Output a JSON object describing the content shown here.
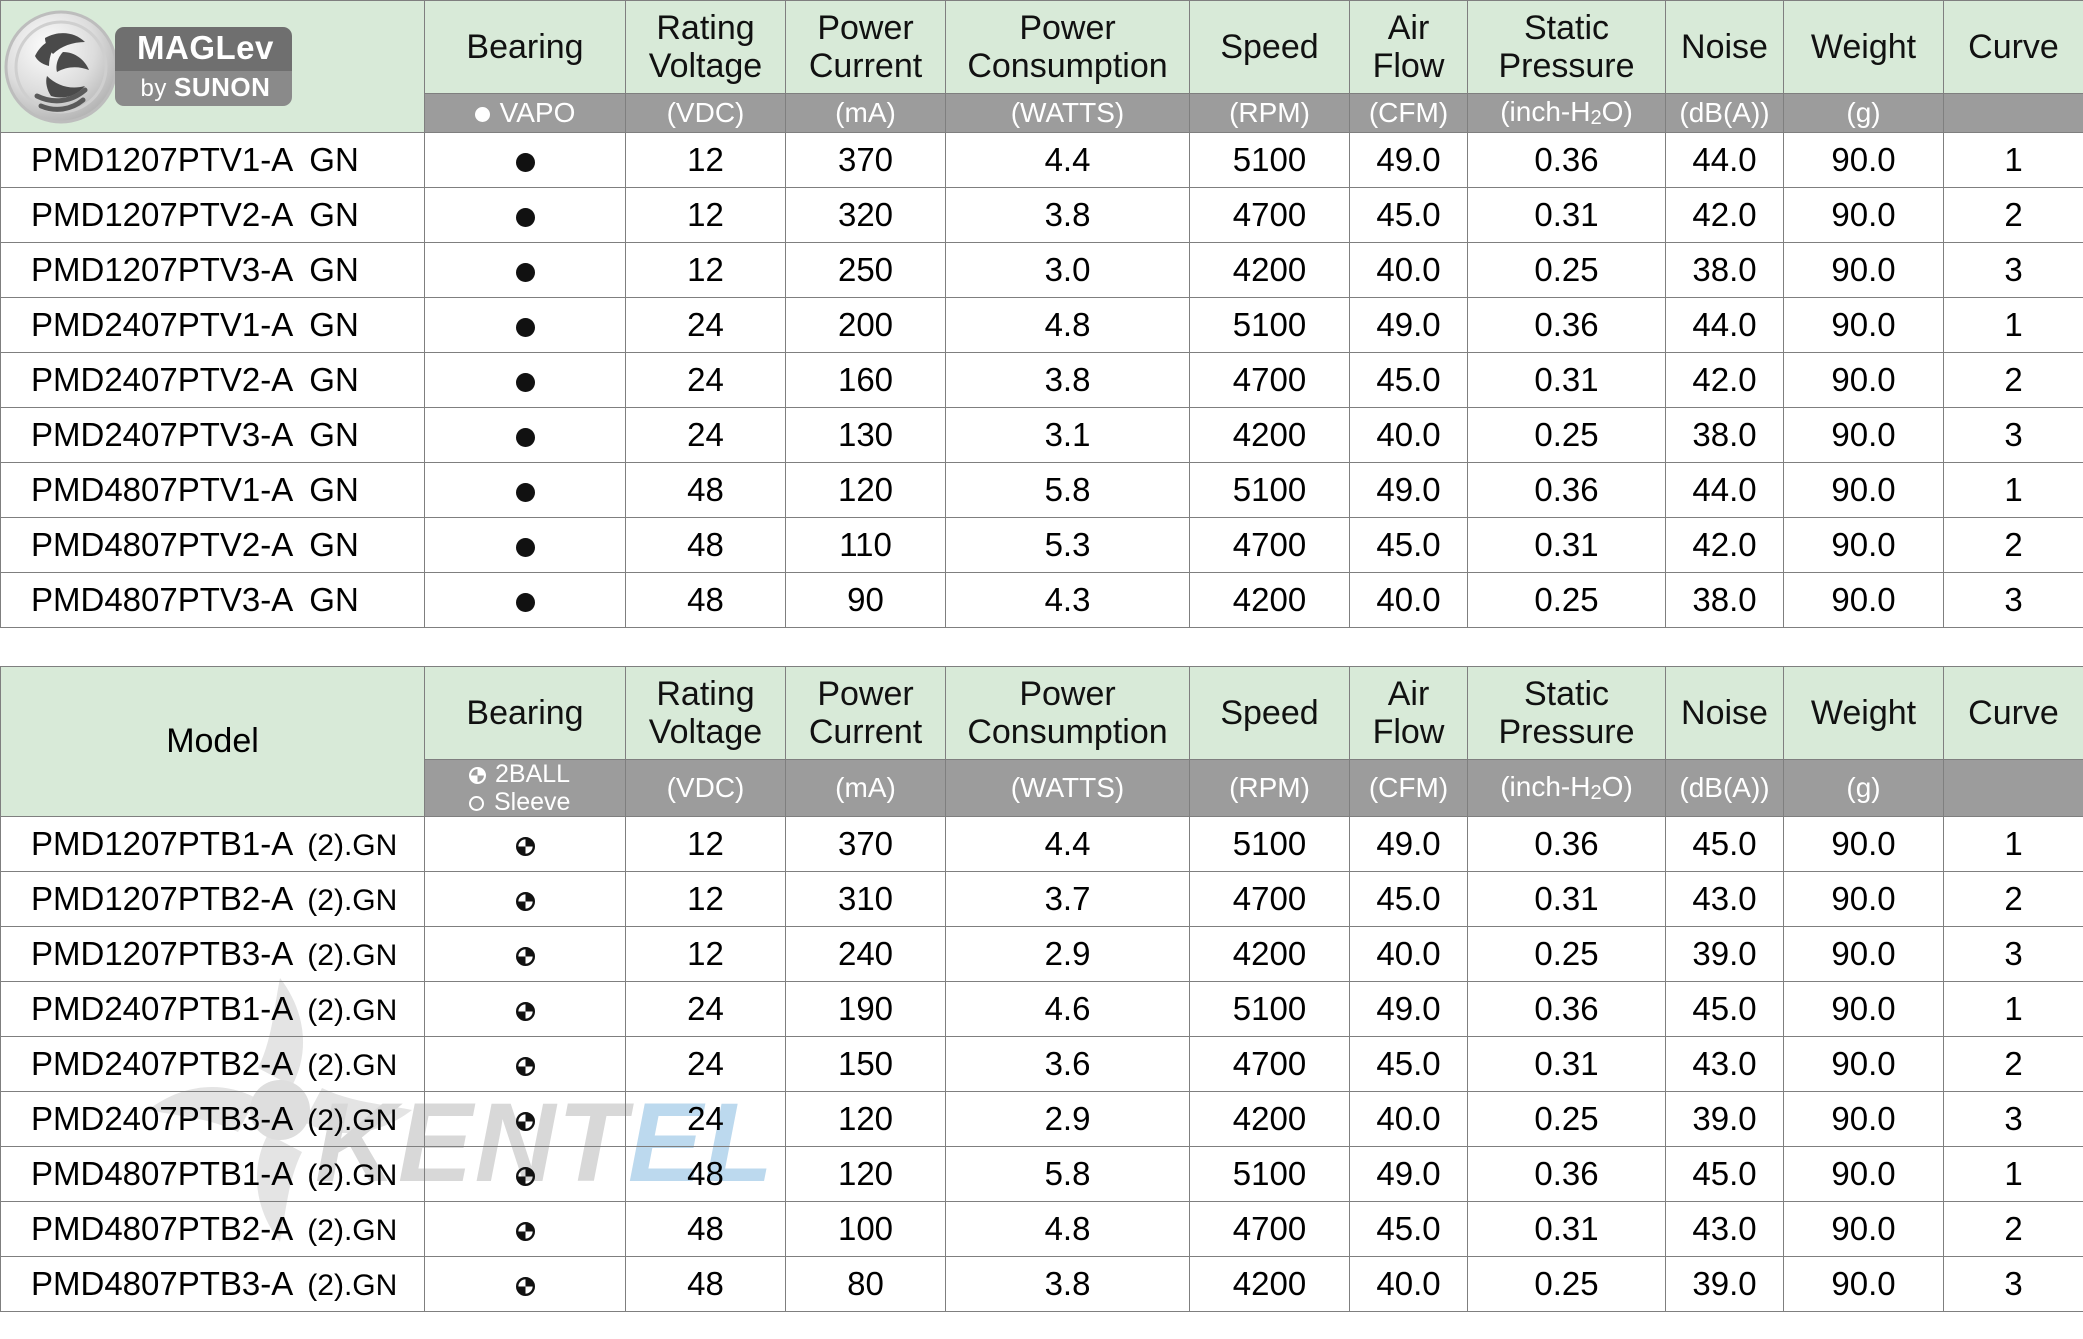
{
  "logo": {
    "brand_top": "MAGLev",
    "brand_bottom_prefix": "by ",
    "brand_bottom_name": "SUNON",
    "icon": "maglev-swirl-icon"
  },
  "watermark": {
    "text_dark": "KENT",
    "text_blue": "EL"
  },
  "columns": {
    "model": "Model",
    "bearing": "Bearing",
    "rating_voltage_l1": "Rating",
    "rating_voltage_l2": "Voltage",
    "power_current_l1": "Power",
    "power_current_l2": "Current",
    "power_consumption_l1": "Power",
    "power_consumption_l2": "Consumption",
    "speed": "Speed",
    "air_flow_l1": "Air",
    "air_flow_l2": "Flow",
    "static_pressure_l1": "Static",
    "static_pressure_l2": "Pressure",
    "noise": "Noise",
    "weight": "Weight",
    "curve": "Curve"
  },
  "units": {
    "bearing_vapo": "VAPO",
    "bearing_2ball": "2BALL",
    "bearing_sleeve": "Sleeve",
    "voltage": "(VDC)",
    "current": "(mA)",
    "consumption": "(WATTS)",
    "speed": "(RPM)",
    "air_flow": "(CFM)",
    "static_pressure_pre": "(inch-H",
    "static_pressure_sub": "2",
    "static_pressure_post": "O)",
    "noise": "(dB(A))",
    "weight": "(g)",
    "curve": ""
  },
  "table1": {
    "bearing_symbol": "filled-circle",
    "rows": [
      {
        "model": "PMD1207PTV1-A",
        "suffix": "GN",
        "voltage": "12",
        "current": "370",
        "consumption": "4.4",
        "speed": "5100",
        "air_flow": "49.0",
        "static_pressure": "0.36",
        "noise": "44.0",
        "weight": "90.0",
        "curve": "1"
      },
      {
        "model": "PMD1207PTV2-A",
        "suffix": "GN",
        "voltage": "12",
        "current": "320",
        "consumption": "3.8",
        "speed": "4700",
        "air_flow": "45.0",
        "static_pressure": "0.31",
        "noise": "42.0",
        "weight": "90.0",
        "curve": "2"
      },
      {
        "model": "PMD1207PTV3-A",
        "suffix": "GN",
        "voltage": "12",
        "current": "250",
        "consumption": "3.0",
        "speed": "4200",
        "air_flow": "40.0",
        "static_pressure": "0.25",
        "noise": "38.0",
        "weight": "90.0",
        "curve": "3"
      },
      {
        "model": "PMD2407PTV1-A",
        "suffix": "GN",
        "voltage": "24",
        "current": "200",
        "consumption": "4.8",
        "speed": "5100",
        "air_flow": "49.0",
        "static_pressure": "0.36",
        "noise": "44.0",
        "weight": "90.0",
        "curve": "1"
      },
      {
        "model": "PMD2407PTV2-A",
        "suffix": "GN",
        "voltage": "24",
        "current": "160",
        "consumption": "3.8",
        "speed": "4700",
        "air_flow": "45.0",
        "static_pressure": "0.31",
        "noise": "42.0",
        "weight": "90.0",
        "curve": "2"
      },
      {
        "model": "PMD2407PTV3-A",
        "suffix": "GN",
        "voltage": "24",
        "current": "130",
        "consumption": "3.1",
        "speed": "4200",
        "air_flow": "40.0",
        "static_pressure": "0.25",
        "noise": "38.0",
        "weight": "90.0",
        "curve": "3"
      },
      {
        "model": "PMD4807PTV1-A",
        "suffix": "GN",
        "voltage": "48",
        "current": "120",
        "consumption": "5.8",
        "speed": "5100",
        "air_flow": "49.0",
        "static_pressure": "0.36",
        "noise": "44.0",
        "weight": "90.0",
        "curve": "1"
      },
      {
        "model": "PMD4807PTV2-A",
        "suffix": "GN",
        "voltage": "48",
        "current": "110",
        "consumption": "5.3",
        "speed": "4700",
        "air_flow": "45.0",
        "static_pressure": "0.31",
        "noise": "42.0",
        "weight": "90.0",
        "curve": "2"
      },
      {
        "model": "PMD4807PTV3-A",
        "suffix": "GN",
        "voltage": "48",
        "current": "90",
        "consumption": "4.3",
        "speed": "4200",
        "air_flow": "40.0",
        "static_pressure": "0.25",
        "noise": "38.0",
        "weight": "90.0",
        "curve": "3"
      }
    ]
  },
  "table2": {
    "bearing_symbol": "quartered-circle",
    "rows": [
      {
        "model": "PMD1207PTB1-A",
        "suffix": "(2).GN",
        "voltage": "12",
        "current": "370",
        "consumption": "4.4",
        "speed": "5100",
        "air_flow": "49.0",
        "static_pressure": "0.36",
        "noise": "45.0",
        "weight": "90.0",
        "curve": "1"
      },
      {
        "model": "PMD1207PTB2-A",
        "suffix": "(2).GN",
        "voltage": "12",
        "current": "310",
        "consumption": "3.7",
        "speed": "4700",
        "air_flow": "45.0",
        "static_pressure": "0.31",
        "noise": "43.0",
        "weight": "90.0",
        "curve": "2"
      },
      {
        "model": "PMD1207PTB3-A",
        "suffix": "(2).GN",
        "voltage": "12",
        "current": "240",
        "consumption": "2.9",
        "speed": "4200",
        "air_flow": "40.0",
        "static_pressure": "0.25",
        "noise": "39.0",
        "weight": "90.0",
        "curve": "3"
      },
      {
        "model": "PMD2407PTB1-A",
        "suffix": "(2).GN",
        "voltage": "24",
        "current": "190",
        "consumption": "4.6",
        "speed": "5100",
        "air_flow": "49.0",
        "static_pressure": "0.36",
        "noise": "45.0",
        "weight": "90.0",
        "curve": "1"
      },
      {
        "model": "PMD2407PTB2-A",
        "suffix": "(2).GN",
        "voltage": "24",
        "current": "150",
        "consumption": "3.6",
        "speed": "4700",
        "air_flow": "45.0",
        "static_pressure": "0.31",
        "noise": "43.0",
        "weight": "90.0",
        "curve": "2"
      },
      {
        "model": "PMD2407PTB3-A",
        "suffix": "(2).GN",
        "voltage": "24",
        "current": "120",
        "consumption": "2.9",
        "speed": "4200",
        "air_flow": "40.0",
        "static_pressure": "0.25",
        "noise": "39.0",
        "weight": "90.0",
        "curve": "3"
      },
      {
        "model": "PMD4807PTB1-A",
        "suffix": "(2).GN",
        "voltage": "48",
        "current": "120",
        "consumption": "5.8",
        "speed": "5100",
        "air_flow": "49.0",
        "static_pressure": "0.36",
        "noise": "45.0",
        "weight": "90.0",
        "curve": "1"
      },
      {
        "model": "PMD4807PTB2-A",
        "suffix": "(2).GN",
        "voltage": "48",
        "current": "100",
        "consumption": "4.8",
        "speed": "4700",
        "air_flow": "45.0",
        "static_pressure": "0.31",
        "noise": "43.0",
        "weight": "90.0",
        "curve": "2"
      },
      {
        "model": "PMD4807PTB3-A",
        "suffix": "(2).GN",
        "voltage": "48",
        "current": "80",
        "consumption": "3.8",
        "speed": "4200",
        "air_flow": "40.0",
        "static_pressure": "0.25",
        "noise": "39.0",
        "weight": "90.0",
        "curve": "3"
      }
    ]
  },
  "colors": {
    "header_green": "#d8ead8",
    "header_gray": "#9c9c9c",
    "border": "#7f7f7f",
    "watermark_blue": "#bcd9ee"
  }
}
